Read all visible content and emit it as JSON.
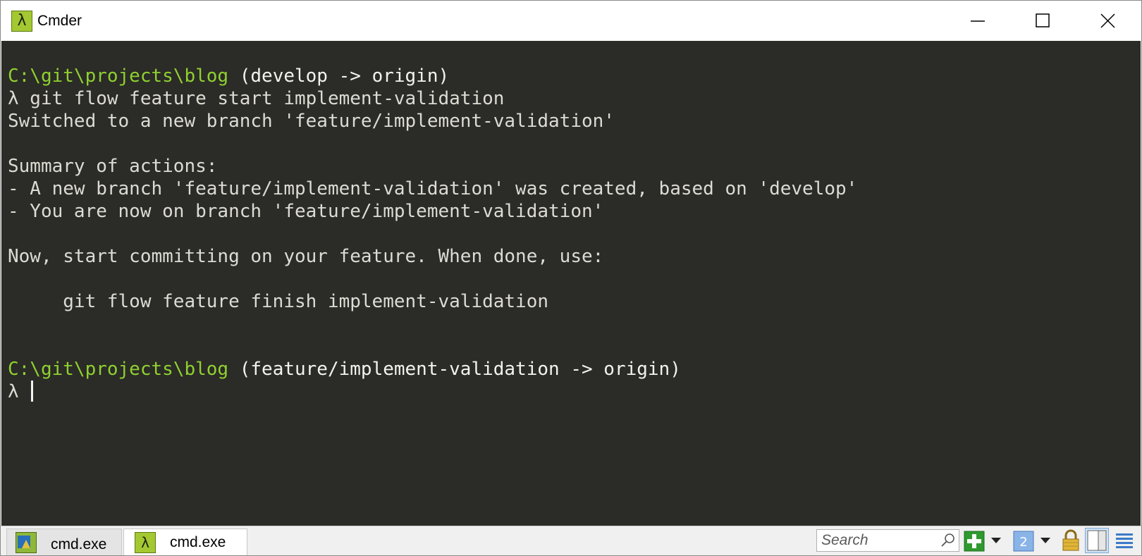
{
  "window": {
    "title": "Cmder",
    "app_icon_glyph": "λ",
    "controls": [
      "minimize-icon",
      "maximize-icon",
      "close-icon"
    ]
  },
  "terminal": {
    "background": "#2b2b27",
    "path_color": "#8fd12f",
    "lines": [
      {
        "path": "C:\\git\\projects\\blog",
        "branch": " (develop -> origin)"
      },
      {
        "text": "λ git flow feature start implement-validation"
      },
      {
        "text": "Switched to a new branch 'feature/implement-validation'"
      },
      {
        "text": "Summary of actions:"
      },
      {
        "text": "- A new branch 'feature/implement-validation' was created, based on 'develop'"
      },
      {
        "text": "- You are now on branch 'feature/implement-validation'"
      },
      {
        "text": "Now, start committing on your feature. When done, use:"
      },
      {
        "text": "     git flow feature finish implement-validation"
      },
      {
        "path": "C:\\git\\projects\\blog",
        "branch": " (feature/implement-validation -> origin)"
      },
      {
        "text": "λ "
      }
    ]
  },
  "statusbar": {
    "tabs": [
      {
        "label": "cmd.exe",
        "icon": "cmd-icon",
        "active": false
      },
      {
        "label": "cmd.exe",
        "icon": "lambda-icon",
        "glyph": "λ",
        "active": true
      }
    ],
    "search": {
      "placeholder": "Search"
    },
    "tools": [
      "new-console-icon",
      "dropdown-icon",
      "split-icon",
      "dropdown-icon",
      "lock-icon",
      "pane-layout-icon",
      "menu-icon"
    ]
  }
}
